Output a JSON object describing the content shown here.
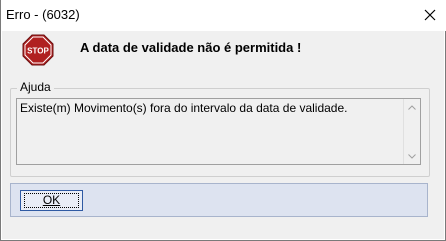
{
  "window": {
    "title": "Erro - (6032)"
  },
  "message": {
    "text": "A data de validade não é permitida !",
    "icon": "stop-sign-icon",
    "stop_label": "STOP"
  },
  "help": {
    "legend": "Ajuda",
    "text": "Existe(m) Movimento(s) fora do intervalo da data de validade."
  },
  "buttons": {
    "ok_label": "OK"
  },
  "colors": {
    "stop_red": "#b02020",
    "footer_bg": "#dde3f0",
    "button_border": "#2f5aa3"
  }
}
